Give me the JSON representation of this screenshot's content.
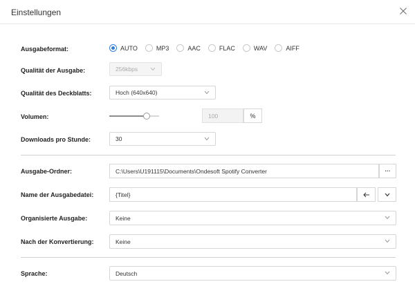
{
  "window": {
    "title": "Einstellungen"
  },
  "output_format": {
    "label": "Ausgabeformat:",
    "options": [
      "AUTO",
      "MP3",
      "AAC",
      "FLAC",
      "WAV",
      "AIFF"
    ],
    "selected": "AUTO"
  },
  "output_quality": {
    "label": "Qualität der Ausgabe:",
    "value": "256kbps"
  },
  "cover_quality": {
    "label": "Qualität des Deckblatts:",
    "value": "Hoch (640x640)"
  },
  "volume": {
    "label": "Volumen:",
    "level_fraction": 0.75,
    "value": "100",
    "unit": "%"
  },
  "downloads_per_hour": {
    "label": "Downloads pro Stunde:",
    "value": "30"
  },
  "output_folder": {
    "label": "Ausgabe-Ordner:",
    "value": "C:\\Users\\U191115\\Documents\\Ondesoft Spotify Converter",
    "browse_label": "···"
  },
  "output_filename": {
    "label": "Name der Ausgabedatei:",
    "value": "{Titel}"
  },
  "organized_output": {
    "label": "Organisierte Ausgabe:",
    "value": "Keine"
  },
  "after_conversion": {
    "label": "Nach der Konvertierung:",
    "value": "Keine"
  },
  "language": {
    "label": "Sprache:",
    "value": "Deutsch"
  }
}
